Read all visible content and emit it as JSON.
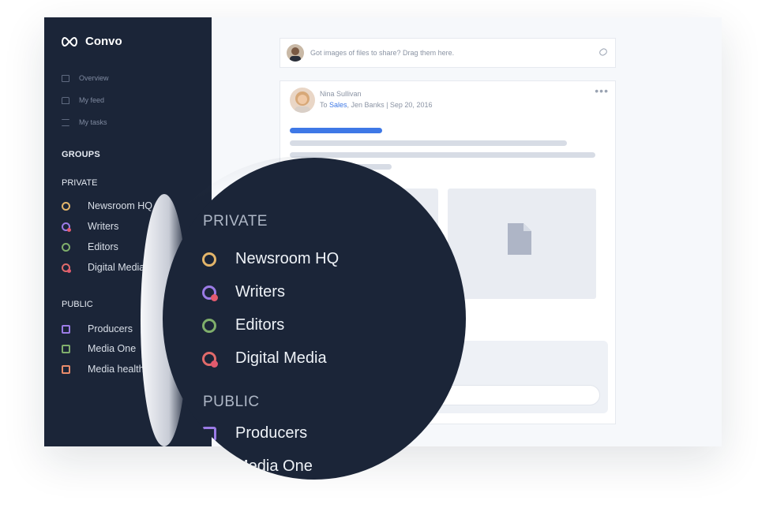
{
  "app": {
    "name": "Convo"
  },
  "sidebar": {
    "nav": [
      {
        "label": "Overview",
        "icon": "grid-icon"
      },
      {
        "label": "My feed",
        "icon": "home-icon"
      },
      {
        "label": "My tasks",
        "icon": "tasks-icon"
      }
    ],
    "groups_title": "GROUPS",
    "private_title": "PRIVATE",
    "private": [
      {
        "label": "Newsroom HQ",
        "color": "#e3b56a"
      },
      {
        "label": "Writers",
        "color": "#9b7be6"
      },
      {
        "label": "Editors",
        "color": "#7fae6b"
      },
      {
        "label": "Digital Media",
        "color": "#e06a6a"
      }
    ],
    "public_title": "PUBLIC",
    "public": [
      {
        "label": "Producers",
        "color": "#9b7be6"
      },
      {
        "label": "Media One",
        "color": "#7fae6b"
      },
      {
        "label": "Media health",
        "color": "#e98b6a"
      }
    ]
  },
  "share": {
    "placeholder": "Got images of files to share? Drag them here."
  },
  "post": {
    "author": "Nina Sullivan",
    "to_prefix": "To",
    "to_group": "Sales",
    "to_rest": ", Jen Banks  |  Sep 20, 2016",
    "accent": "#3e78e6"
  },
  "magnifier": {
    "private_title": "PRIVATE",
    "private": [
      "Newsroom HQ",
      "Writers",
      "Editors",
      "Digital Media"
    ],
    "public_title": "PUBLIC",
    "public": [
      "Producers",
      "Media One"
    ]
  }
}
